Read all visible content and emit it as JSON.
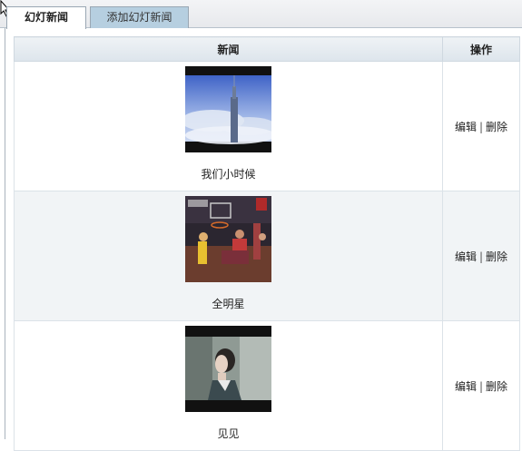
{
  "tabs": [
    {
      "label": "幻灯新闻",
      "active": true
    },
    {
      "label": "添加幻灯新闻",
      "active": false
    }
  ],
  "table": {
    "headers": {
      "news": "新闻",
      "actions": "操作"
    },
    "rows": [
      {
        "title": "我们小时候",
        "image": "skyscraper-in-clouds",
        "edit": "编辑",
        "delete": "删除"
      },
      {
        "title": "全明星",
        "image": "basketball-dunk",
        "edit": "编辑",
        "delete": "删除"
      },
      {
        "title": "见见",
        "image": "woman-portrait",
        "edit": "编辑",
        "delete": "删除"
      }
    ]
  },
  "separator": "|",
  "colors": {
    "tab_inactive": "#b6cfe0",
    "row_alt": "#f1f4f6",
    "header_bg": "#dde5ec"
  }
}
